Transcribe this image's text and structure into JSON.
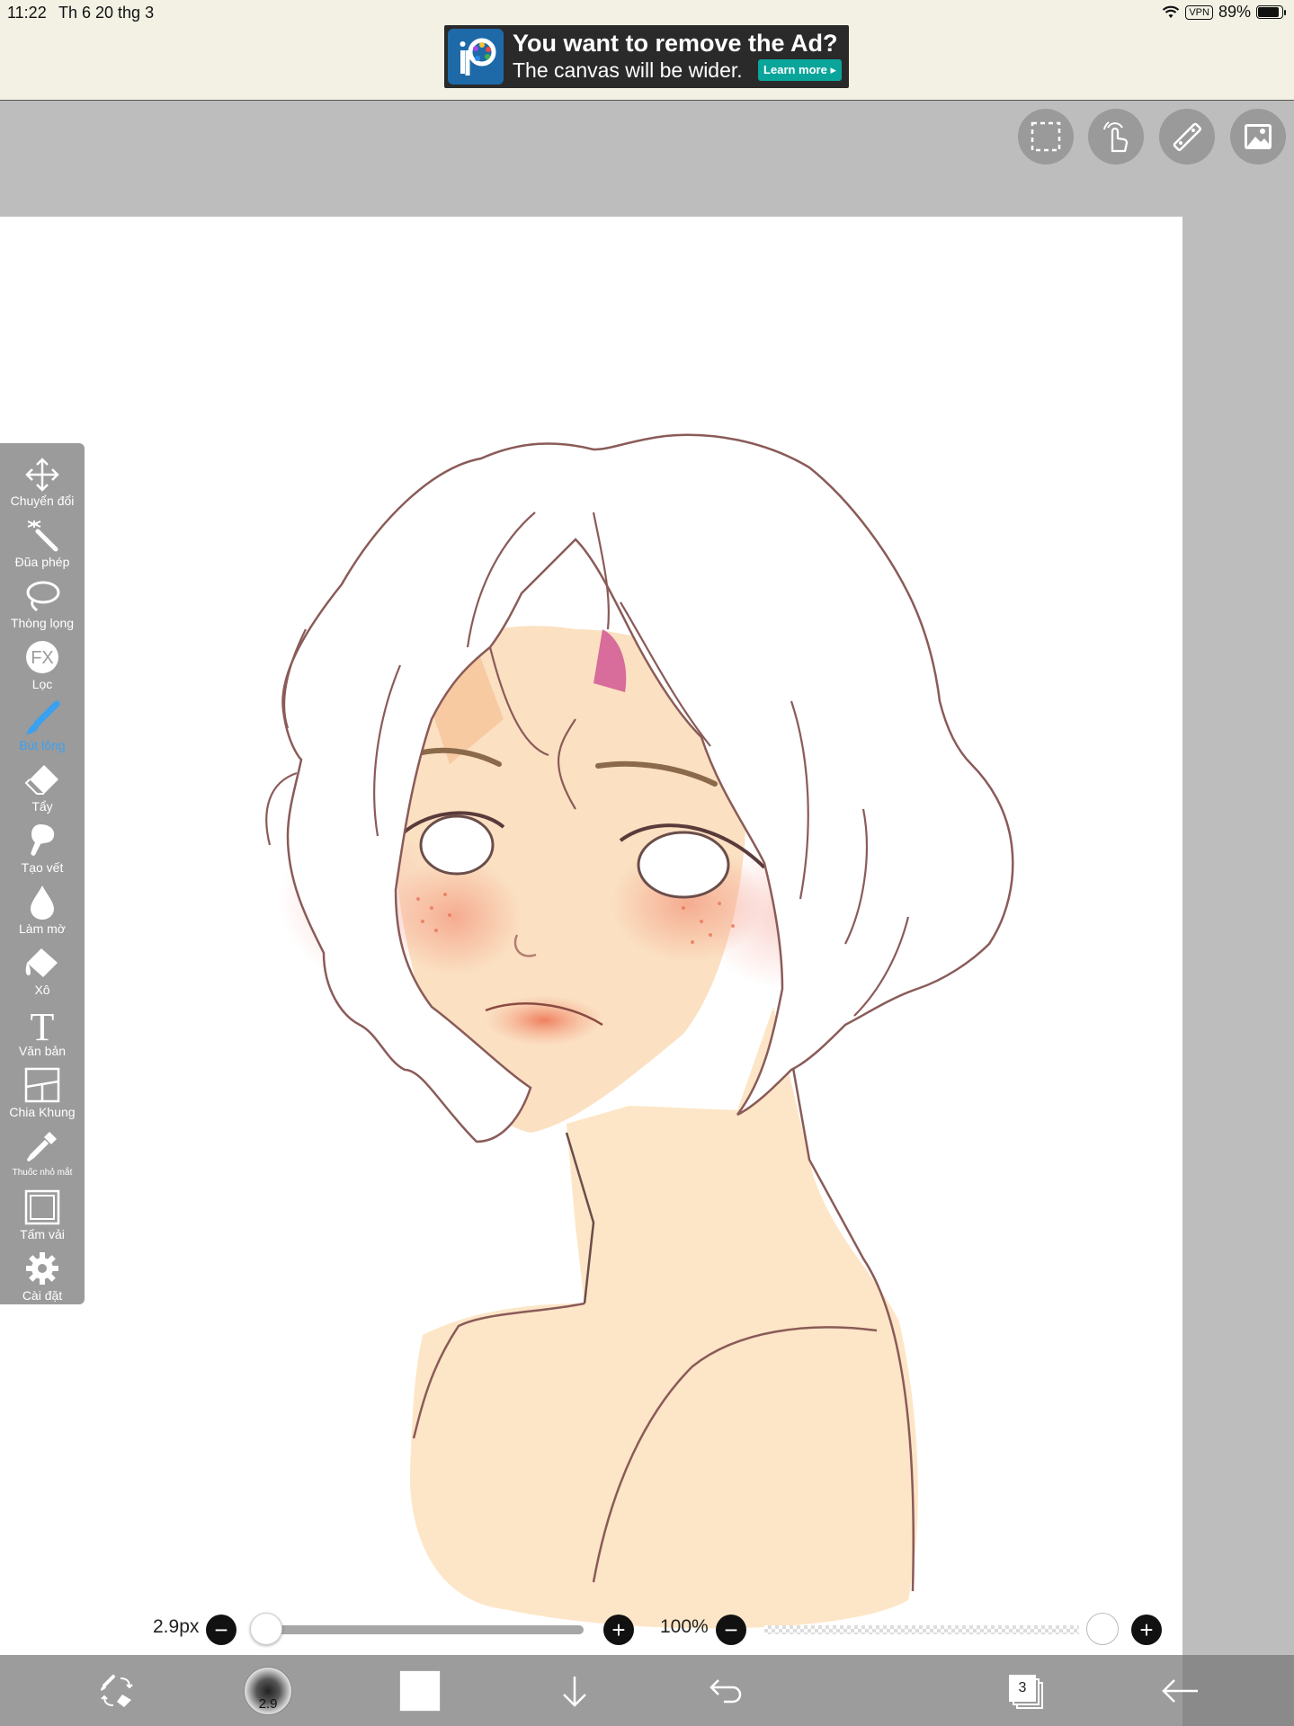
{
  "status_bar": {
    "time": "11:22",
    "date": "Th 6 20 thg 3",
    "vpn": "VPN",
    "battery": "89%"
  },
  "ad": {
    "title": "You want to remove the Ad?",
    "subtitle": "The canvas will be wider.",
    "button": "Learn more"
  },
  "top_tools": [
    "selection-icon",
    "gesture-icon",
    "ruler-icon",
    "reference-image-icon"
  ],
  "left_tools": [
    {
      "label": "Chuyển đổi",
      "icon": "transform-icon"
    },
    {
      "label": "Đũa phép",
      "icon": "magic-wand-icon"
    },
    {
      "label": "Thòng lọng",
      "icon": "lasso-icon"
    },
    {
      "label": "Lọc",
      "icon": "filter-fx-icon"
    },
    {
      "label": "Bút lông",
      "icon": "brush-icon",
      "active": true
    },
    {
      "label": "Tẩy",
      "icon": "eraser-icon"
    },
    {
      "label": "Tạo vết",
      "icon": "smudge-icon"
    },
    {
      "label": "Làm mờ",
      "icon": "blur-icon"
    },
    {
      "label": "Xô",
      "icon": "bucket-icon"
    },
    {
      "label": "Văn bản",
      "icon": "text-icon"
    },
    {
      "label": "Chia Khung",
      "icon": "frame-divider-icon"
    },
    {
      "label": "Thuốc nhỏ mắt",
      "icon": "eyedropper-icon"
    },
    {
      "label": "Tấm vải",
      "icon": "canvas-icon"
    },
    {
      "label": "Cài đặt",
      "icon": "settings-icon"
    }
  ],
  "brush": {
    "size_label": "2.9px",
    "size_fraction": 0.02,
    "opacity_label": "100%",
    "opacity_fraction": 1.0,
    "minus": "−",
    "plus": "+"
  },
  "bottom_bar": {
    "brush_preview_value": "2.9",
    "current_color": "#ffffff",
    "layer_count": "3"
  },
  "colors": {
    "accent_blue": "#3aa0f0",
    "toolbar_gray": "#9b9b9b",
    "workspace_gray": "#bdbdbd",
    "line_art": "#8a5b58",
    "skin": "#fde6c7",
    "blush": "#f6a88a"
  }
}
